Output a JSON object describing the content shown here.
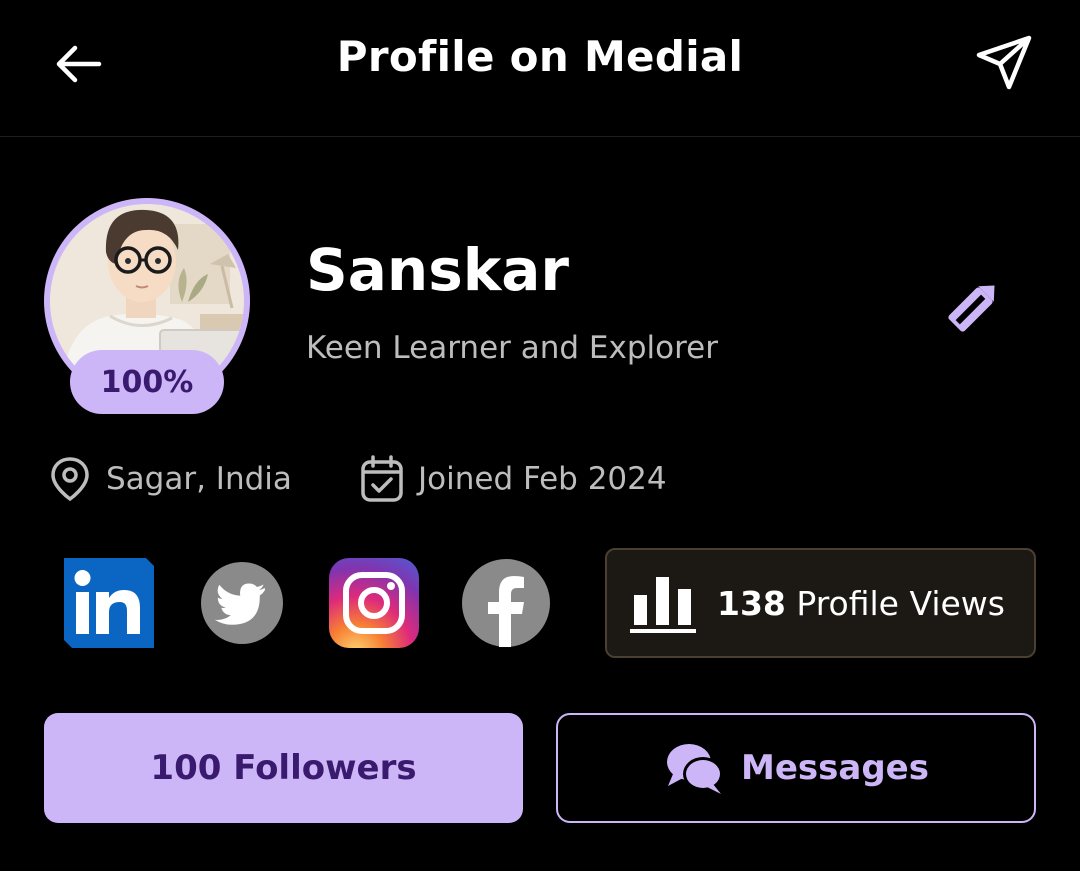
{
  "header": {
    "title": "Profile on Medial",
    "back_icon": "arrow-left-icon",
    "share_icon": "send-icon"
  },
  "profile": {
    "name": "Sanskar",
    "bio": "Keen Learner and Explorer",
    "completion": "100%",
    "location": "Sagar, India",
    "joined": "Joined Feb 2024",
    "edit_icon": "pencil-icon"
  },
  "socials": [
    {
      "name": "LinkedIn",
      "icon": "linkedin-icon"
    },
    {
      "name": "Twitter",
      "icon": "twitter-icon"
    },
    {
      "name": "Instagram",
      "icon": "instagram-icon"
    },
    {
      "name": "Facebook",
      "icon": "facebook-icon"
    }
  ],
  "views": {
    "count": "138",
    "label": " Profile Views"
  },
  "actions": {
    "followers_label": "100 Followers",
    "messages_label": "Messages"
  },
  "colors": {
    "accent": "#cdb6f7",
    "accent_text": "#3a1a6e",
    "background": "#000000",
    "muted_text": "#bdbdbd",
    "views_border": "#4a3f32"
  }
}
